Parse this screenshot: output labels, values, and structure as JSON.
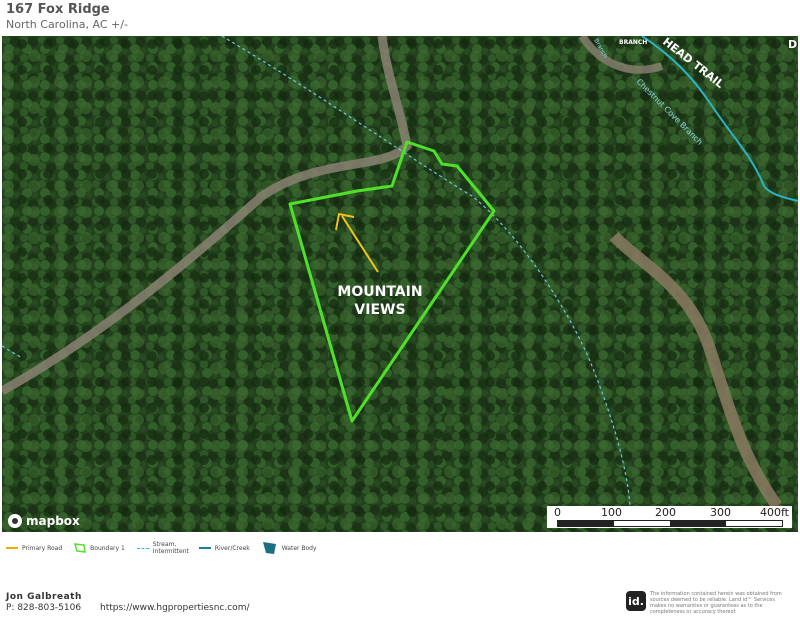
{
  "header": {
    "title": "167 Fox Ridge",
    "subtitle": "North Carolina,  AC +/-"
  },
  "map": {
    "annotation": "MOUNTAIN\nVIEWS",
    "road_labels": [
      "BRANCH",
      "HEAD TRAIL",
      "D"
    ],
    "stream_labels": [
      "Chestnut Cove Branch",
      "Branch"
    ],
    "attribution": "mapbox",
    "colors": {
      "boundary": "#4fe02a",
      "arrow": "#f2c21b",
      "stream": "#6fc9e0",
      "river": "#2bb3c4",
      "forest": "#1f3a1a"
    }
  },
  "scale": {
    "labels": [
      "0",
      "100",
      "200",
      "300",
      "400ft"
    ]
  },
  "legend": {
    "items": [
      {
        "label": "Primary Road",
        "icon": "line-icon",
        "color": "#e8b000"
      },
      {
        "label": "Boundary 1",
        "icon": "polygon-icon",
        "color": "#4fe02a"
      },
      {
        "label": "Stream, Intermittent",
        "icon": "dashed-line-icon",
        "color": "#2bb3c4"
      },
      {
        "label": "River/Creek",
        "icon": "line-icon",
        "color": "#1c7fa0"
      },
      {
        "label": "Water Body",
        "icon": "polygon-icon",
        "color": "#1a6f80"
      }
    ]
  },
  "footer": {
    "agent_name": "Jon  Galbreath",
    "phone": "P: 828-803-5106",
    "url": "https://www.hgpropertiesnc.com/",
    "logo_text": "id.",
    "disclaimer": "The information contained herein was obtained from sources deemed to be reliable. Land id™ Services makes no warranties or guarantees as to the completeness or accuracy thereof."
  }
}
